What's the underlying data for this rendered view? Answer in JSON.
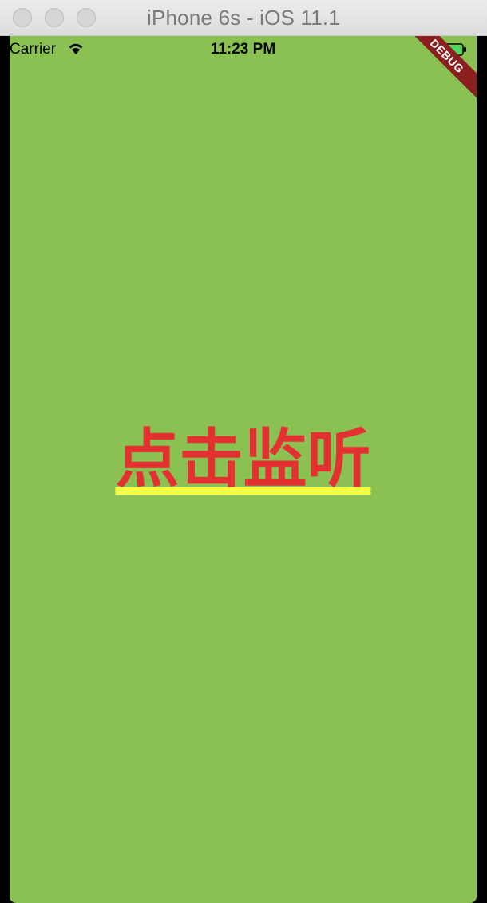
{
  "window": {
    "title": "iPhone 6s - iOS 11.1",
    "controls": [
      "close",
      "minimize",
      "zoom"
    ]
  },
  "statusbar": {
    "carrier": "Carrier",
    "time": "11:23 PM",
    "icons": [
      "wifi-icon",
      "battery-icon"
    ]
  },
  "debug_banner": {
    "label": "DEBUG"
  },
  "main": {
    "text": "点击监听"
  },
  "colors": {
    "background": "#8bc152",
    "text": "#e33131",
    "underline": "#ffff3c",
    "debug_banner": "#8b1f1f",
    "battery": "#4cd964"
  }
}
